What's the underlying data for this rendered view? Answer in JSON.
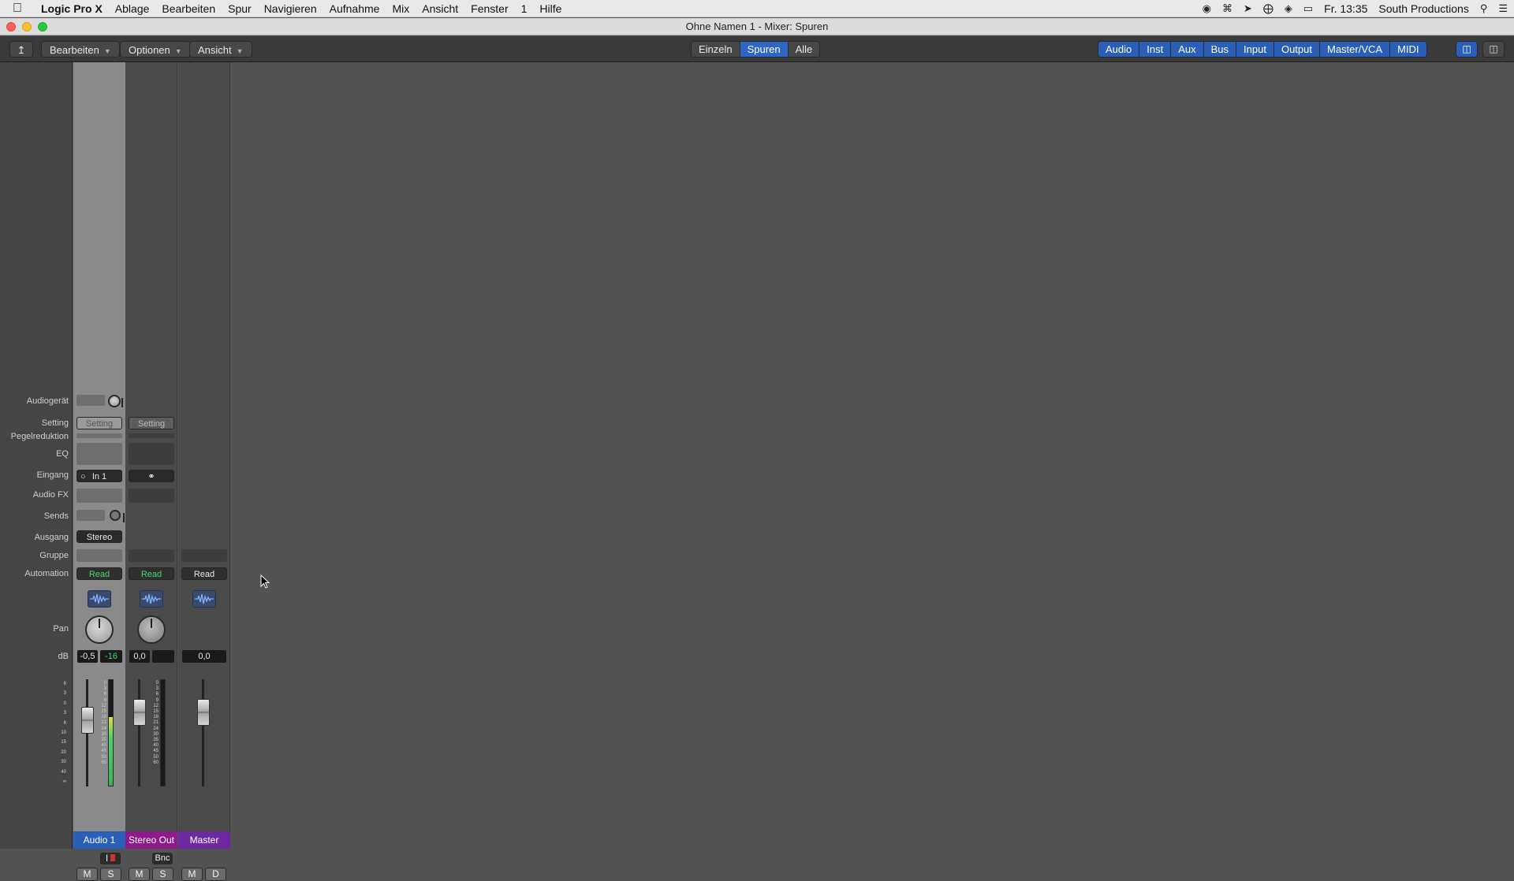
{
  "menubar": {
    "app": "Logic Pro X",
    "items": [
      "Ablage",
      "Bearbeiten",
      "Spur",
      "Navigieren",
      "Aufnahme",
      "Mix",
      "Ansicht",
      "Fenster",
      "1",
      "Hilfe"
    ],
    "clock": "Fr. 13:35",
    "user": "South Productions"
  },
  "window": {
    "title": "Ohne Namen 1 - Mixer: Spuren"
  },
  "toolbar": {
    "menus": [
      "Bearbeiten",
      "Optionen",
      "Ansicht"
    ],
    "view_modes": [
      "Einzeln",
      "Spuren",
      "Alle"
    ],
    "active_view_mode": "Spuren",
    "filters": [
      "Audio",
      "Inst",
      "Aux",
      "Bus",
      "Input",
      "Output",
      "Master/VCA",
      "MIDI"
    ]
  },
  "row_labels": {
    "audio_device": "Audiogerät",
    "setting": "Setting",
    "gain_reduction": "Pegelreduktion",
    "eq": "EQ",
    "input": "Eingang",
    "audio_fx": "Audio FX",
    "sends": "Sends",
    "output": "Ausgang",
    "group": "Gruppe",
    "automation": "Automation",
    "pan": "Pan",
    "db": "dB"
  },
  "strips": [
    {
      "name": "Audio 1",
      "color": "#2a5fb8",
      "setting": "Setting",
      "input": "In 1",
      "output": "Stereo",
      "automation": "Read",
      "volume_db": "-0,5",
      "peak_db": "-16",
      "level_fraction": 0.65,
      "input_monitor": "I",
      "mute": "M",
      "solo": "S"
    },
    {
      "name": "Stereo Out",
      "color": "#8e1a8c",
      "setting": "Setting",
      "output": "",
      "automation": "Read",
      "volume_db": "0,0",
      "bounce": "Bnc",
      "mute": "M",
      "solo": "S"
    },
    {
      "name": "Master",
      "color": "#6d2aa0",
      "automation": "Read",
      "volume_db": "0,0",
      "mute": "M",
      "dim": "D"
    }
  ],
  "fader_scale": [
    "6",
    "3",
    "0",
    "3",
    "6",
    "10",
    "15",
    "20",
    "30",
    "40",
    "∞"
  ],
  "meter_scale": [
    "0",
    "3",
    "6",
    "9",
    "12",
    "15",
    "18",
    "21",
    "24",
    "30",
    "35",
    "40",
    "45",
    "50",
    "60"
  ]
}
